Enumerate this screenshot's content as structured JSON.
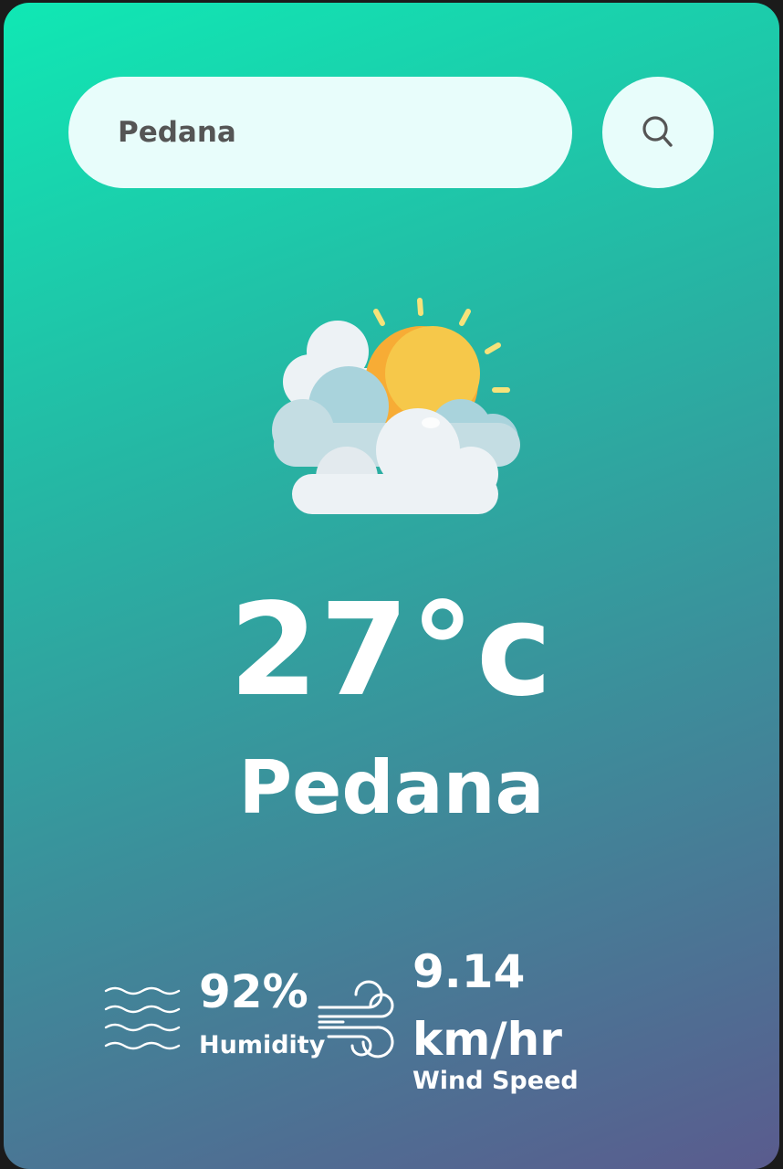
{
  "search": {
    "value": "Pedana",
    "icon": "search-icon"
  },
  "weather": {
    "icon": "partly-cloudy-icon",
    "temperature": "27°c",
    "city": "Pedana"
  },
  "humidity": {
    "icon": "humidity-waves-icon",
    "value": "92%",
    "label": "Humidity"
  },
  "wind": {
    "icon": "wind-icon",
    "value": "9.14 km/hr",
    "label": "Wind Speed"
  },
  "colors": {
    "gradient_start": "#10e8b4",
    "gradient_end": "#5a5b8e",
    "input_background": "#e8fdfb",
    "text_light": "#ffffff"
  }
}
